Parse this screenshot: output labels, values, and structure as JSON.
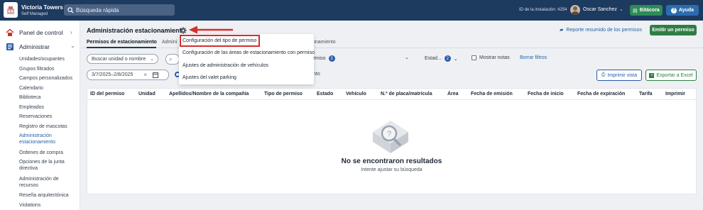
{
  "topbar": {
    "org_name": "Victoria Towers",
    "org_subtitle": "Self Managed",
    "search_placeholder": "Búsqueda rápida",
    "installation_id": "ID de la instalación: 4254",
    "user_name": "Oscar Sanchez",
    "bitacora_label": "Bitácora",
    "ayuda_label": "Ayuda"
  },
  "sidebar": {
    "panel_label": "Panel de control",
    "admin_label": "Administrar",
    "items": [
      "Unidades/ocupantes",
      "Grupos filtrados",
      "Campos personalizados",
      "Calendario",
      "Biblioteca",
      "Empleados",
      "Reservaciones",
      "Registro de mascotas",
      "Administración estacionamiento",
      "Órdenes de compra",
      "Opciones de la junta directiva",
      "Administración de recursos",
      "Reseña arquitectónica",
      "Violations"
    ]
  },
  "header": {
    "title": "Administración estacionamiento",
    "summary_link": "Reporte resumido de los permisos",
    "issue_button": "Emitir un permiso"
  },
  "tabs": {
    "permits": "Permisos de estacionamiento",
    "admin_partial": "Admini",
    "right_partial": "onamiento"
  },
  "filters": {
    "unit_placeholder": "Buscar unidad o nombre",
    "permits_label": "lermiso",
    "permits_count": "3",
    "status_label": "Estad...",
    "status_count": "2",
    "show_notes": "Mostrar notas",
    "clear_filters": "Borrar filtros",
    "date_range": "3/7/2025–2/8/2025",
    "partial_text": "nto",
    "print_view": "Imprimir vista",
    "export_excel": "Exportar a Excel"
  },
  "table": {
    "columns": [
      "ID del permiso",
      "Unidad",
      "Apellidos/Nombre de la compañía",
      "Tipo de permiso",
      "Estado",
      "Vehículo",
      "N.º de placa/matrícula",
      "Área",
      "Fecha de emisión",
      "Fecha de inicio",
      "Fecha de expiración",
      "Tarifa",
      "Imprimir"
    ],
    "empty_title": "No se encontraron resultados",
    "empty_subtitle": "Intente ajustar su búsqueda"
  },
  "dropdown": {
    "items": [
      "Configuración del tipo de permiso",
      "Configuración de las áreas de estacionamiento con permiso",
      "Ajustes de administración de vehículos",
      "Ajustes del valet parking"
    ]
  },
  "colors": {
    "topbar": "#1d3a5f",
    "accent_green": "#2e7d46",
    "accent_blue": "#2b6cb0",
    "highlight_red": "#d32f2f"
  }
}
